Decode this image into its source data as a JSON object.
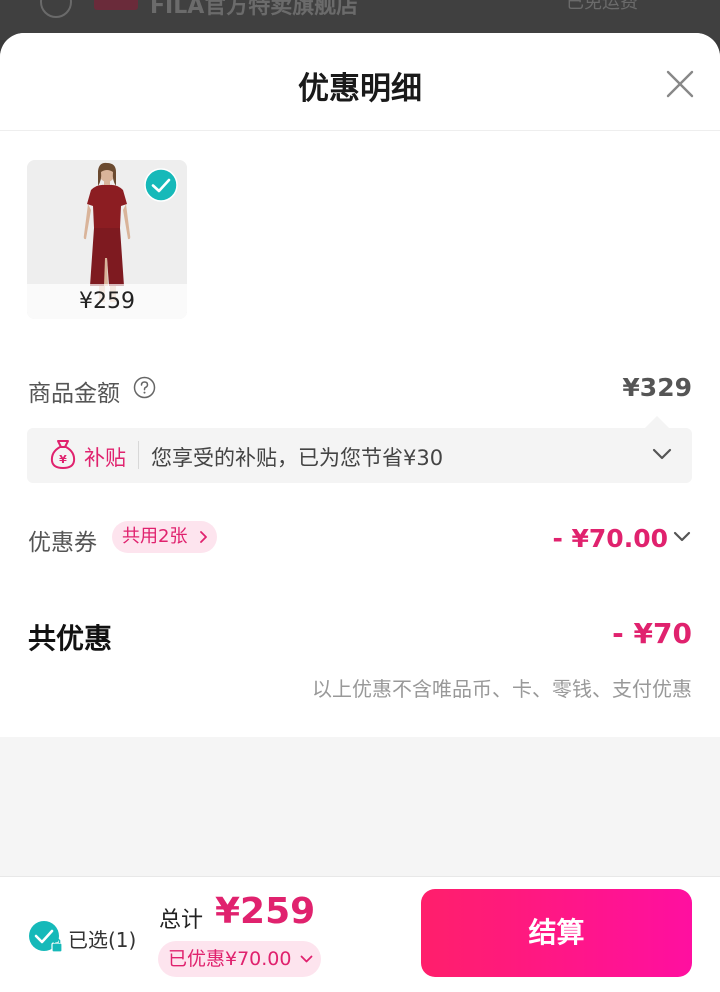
{
  "background": {
    "store_name": "FILA官方特卖旗舰店",
    "right_text": "已免运费"
  },
  "sheet": {
    "title": "优惠明细"
  },
  "product": {
    "price": "¥259",
    "selected": true
  },
  "goods": {
    "label": "商品金额",
    "amount": "¥329"
  },
  "subsidy": {
    "tag": "补贴",
    "text": "您享受的补贴，已为您节省¥30"
  },
  "coupon": {
    "label": "优惠券",
    "badge": "共用2张",
    "amount": "- ¥70.00"
  },
  "total_discount": {
    "label": "共优惠",
    "amount": "- ¥70",
    "note": "以上优惠不含唯品币、卡、零钱、支付优惠"
  },
  "footer": {
    "selected_label": "已选(1)",
    "sum_label": "总计",
    "sum_amount": "¥259",
    "saved": "已优惠¥70.00",
    "checkout": "结算"
  },
  "colors": {
    "accent": "#e0226e",
    "teal": "#16b9b9",
    "button_gradient": [
      "#ff1f6b",
      "#ff0fa0"
    ]
  }
}
